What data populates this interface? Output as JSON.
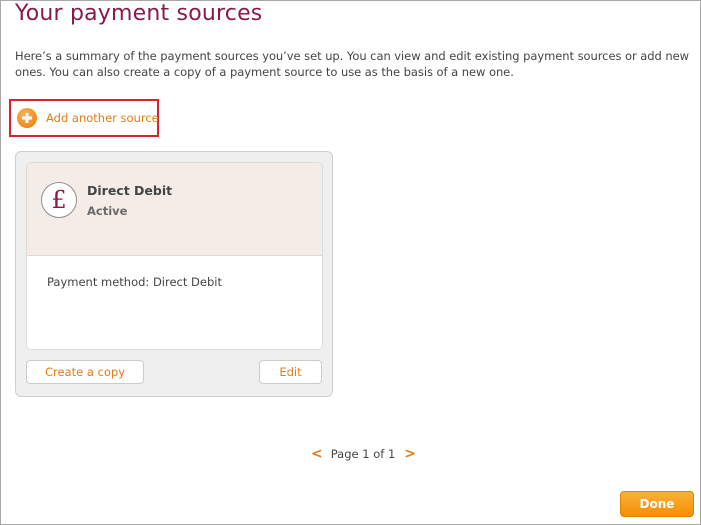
{
  "page": {
    "title": "Your payment sources",
    "intro_line1": "Here’s a summary of the payment sources you’ve set up. You can view and edit existing payment sources or add new",
    "intro_line2": "ones. You can also create a copy of a payment source to use as the basis of a new one."
  },
  "add_source": {
    "label": "Add another source",
    "icon": "plus-circle-icon"
  },
  "payment_source": {
    "icon": "pound-sign-icon",
    "glyph": "£",
    "name": "Direct Debit",
    "status": "Active",
    "method_text": "Payment method: Direct Debit",
    "copy_label": "Create a copy",
    "edit_label": "Edit"
  },
  "pagination": {
    "prev": "<",
    "text": "Page 1 of 1",
    "next": ">"
  },
  "footer": {
    "done_label": "Done"
  },
  "colors": {
    "title": "#8b1a4c",
    "accent": "#e57c16",
    "highlight_border": "#d9232d",
    "card_header": "#f4ece6",
    "done_button": "#f39000"
  }
}
